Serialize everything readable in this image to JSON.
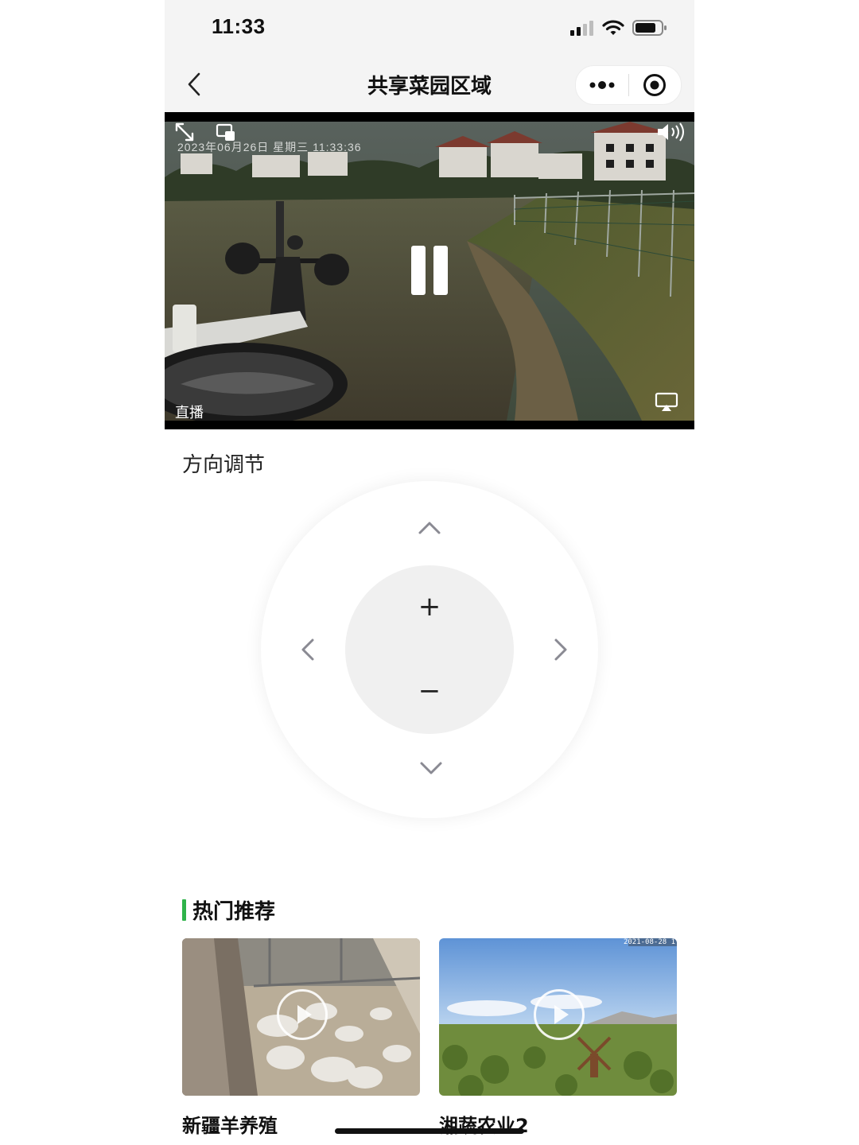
{
  "status_bar": {
    "time": "11:33",
    "icons": [
      "signal-icon",
      "wifi-icon",
      "battery-icon"
    ]
  },
  "nav": {
    "title": "共享菜园区域",
    "back_icon": "chevron-left-icon",
    "menu_icon": "more-dots-icon",
    "close_icon": "target-circle-icon"
  },
  "video": {
    "osd_timestamp": "2023年06月26日 星期三 11:33:36",
    "live_label": "直播",
    "state": "playing",
    "icons": [
      "fullscreen-icon",
      "pip-icon",
      "volume-icon",
      "airplay-icon",
      "pause-icon"
    ]
  },
  "direction": {
    "title": "方向调节",
    "zoom_in_label": "+",
    "zoom_out_label": "−",
    "icons": [
      "arrow-up-icon",
      "arrow-down-icon",
      "arrow-left-icon",
      "arrow-right-icon"
    ]
  },
  "hot": {
    "title": "热门推荐",
    "items": [
      {
        "name": "新疆羊养殖"
      },
      {
        "name": "湘蔬农业2",
        "overlay_timestamp": "2021-08-28 1"
      }
    ]
  },
  "colors": {
    "accent_green": "#2fb34a",
    "nav_bg": "#f4f4f4",
    "ptz_inner": "#f0f0f0"
  }
}
